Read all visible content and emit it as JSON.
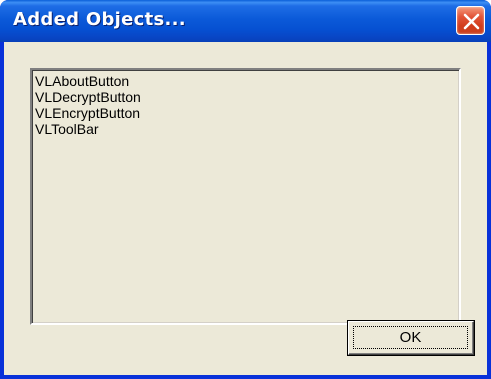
{
  "dialog": {
    "title": "Added Objects...",
    "close_icon": "close-icon"
  },
  "list": {
    "items": [
      "VLAboutButton",
      "VLDecryptButton",
      "VLEncryptButton",
      "VLToolBar"
    ]
  },
  "buttons": {
    "ok_label": "OK"
  },
  "colors": {
    "titlebar": "#0b5ad9",
    "close_button": "#d9552f",
    "dialog_face": "#ece9d8"
  }
}
